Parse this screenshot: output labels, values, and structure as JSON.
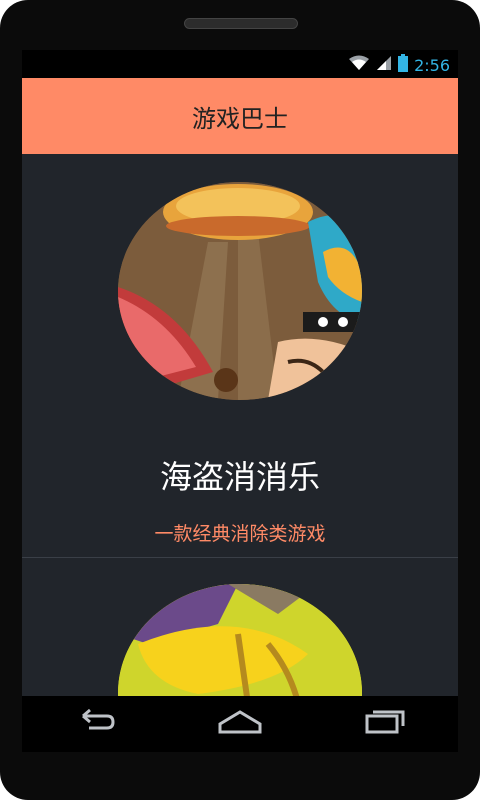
{
  "status_bar": {
    "time": "2:56",
    "icons": [
      "wifi-icon",
      "signal-icon",
      "battery-icon"
    ],
    "color": "#33b5e5"
  },
  "app_bar": {
    "title": "游戏巴士",
    "color": "#ff8a66"
  },
  "games": [
    {
      "name": "海盗消消乐",
      "description": "一款经典消除类游戏",
      "icon": "pirate-game-avatar"
    },
    {
      "name": "",
      "description": "",
      "icon": "second-game-avatar"
    }
  ],
  "nav_bar": {
    "buttons": [
      "back-icon",
      "home-icon",
      "recents-icon"
    ]
  },
  "colors": {
    "background": "#21252b",
    "accent": "#ff8a66",
    "title_text": "#222222",
    "name_text": "#ffffff"
  }
}
